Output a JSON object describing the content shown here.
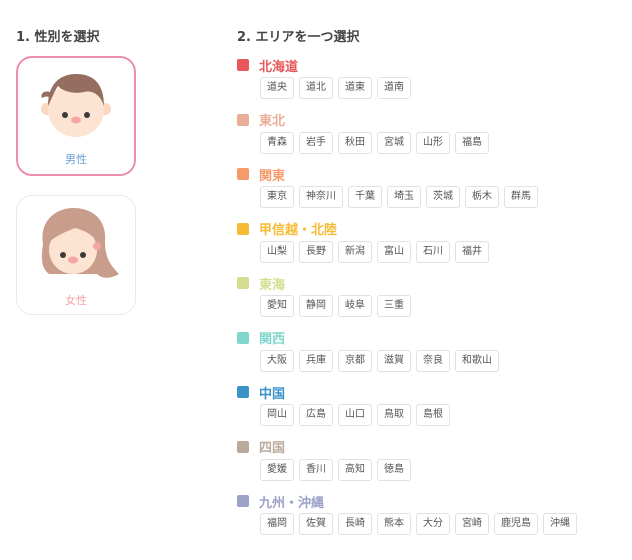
{
  "gender_section": {
    "title": "1. 性別を選択",
    "options": [
      {
        "label": "男性",
        "icon": "male-face-icon",
        "selected": true
      },
      {
        "label": "女性",
        "icon": "female-face-icon",
        "selected": false
      }
    ]
  },
  "area_section": {
    "title": "2. エリアを一つ選択",
    "regions": [
      {
        "name": "北海道",
        "color": "#e8585a",
        "prefectures": [
          "道央",
          "道北",
          "道東",
          "道南"
        ]
      },
      {
        "name": "東北",
        "color": "#e9ad98",
        "prefectures": [
          "青森",
          "岩手",
          "秋田",
          "宮城",
          "山形",
          "福島"
        ]
      },
      {
        "name": "関東",
        "color": "#f59a6b",
        "prefectures": [
          "東京",
          "神奈川",
          "千葉",
          "埼玉",
          "茨城",
          "栃木",
          "群馬"
        ]
      },
      {
        "name": "甲信越・北陸",
        "color": "#f6bb37",
        "prefectures": [
          "山梨",
          "長野",
          "新潟",
          "富山",
          "石川",
          "福井"
        ]
      },
      {
        "name": "東海",
        "color": "#d4de8e",
        "prefectures": [
          "愛知",
          "静岡",
          "岐阜",
          "三重"
        ]
      },
      {
        "name": "関西",
        "color": "#7fd6cc",
        "prefectures": [
          "大阪",
          "兵庫",
          "京都",
          "滋賀",
          "奈良",
          "和歌山"
        ]
      },
      {
        "name": "中国",
        "color": "#3a92c6",
        "prefectures": [
          "岡山",
          "広島",
          "山口",
          "鳥取",
          "島根"
        ]
      },
      {
        "name": "四国",
        "color": "#b9aa9c",
        "prefectures": [
          "愛媛",
          "香川",
          "高知",
          "徳島"
        ]
      },
      {
        "name": "九州・沖縄",
        "color": "#9da2c9",
        "prefectures": [
          "福岡",
          "佐賀",
          "長崎",
          "熊本",
          "大分",
          "宮崎",
          "鹿児島",
          "沖縄"
        ]
      }
    ]
  }
}
